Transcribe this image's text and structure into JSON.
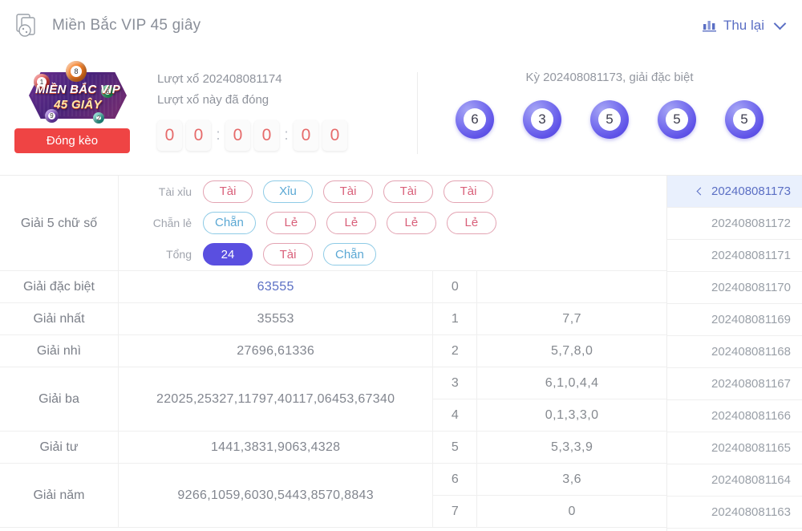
{
  "header": {
    "icon": "cards-dice-icon",
    "title": "Miền Bắc VIP 45 giây",
    "right_icon": "bar-chart-icon",
    "right_label": "Thu lại",
    "right_chevron": "chevron-down-icon"
  },
  "hero": {
    "logo": {
      "line1": "MIỀN BẮC VIP",
      "line2": "45 GIÂY",
      "ball_labels": [
        "8",
        "9",
        "1",
        "6",
        "2"
      ]
    },
    "closed_button": "Đóng kèo",
    "draw_line1": "Lượt xổ 202408081174",
    "draw_line2": "Lượt xổ này đã đóng",
    "timer": [
      "0",
      "0",
      ":",
      "0",
      "0",
      ":",
      "0",
      "0"
    ],
    "result_caption": "Kỳ 202408081173, giải đặc biệt",
    "result_balls": [
      "6",
      "3",
      "5",
      "5",
      "5"
    ]
  },
  "five_digit_block": {
    "label": "Giải 5 chữ số",
    "rows": [
      {
        "label": "Tài xỉu",
        "pills": [
          {
            "text": "Tài",
            "style": "red"
          },
          {
            "text": "Xỉu",
            "style": "cyan"
          },
          {
            "text": "Tài",
            "style": "red"
          },
          {
            "text": "Tài",
            "style": "red"
          },
          {
            "text": "Tài",
            "style": "red"
          }
        ]
      },
      {
        "label": "Chẵn lẻ",
        "pills": [
          {
            "text": "Chẵn",
            "style": "cyan"
          },
          {
            "text": "Lẻ",
            "style": "red"
          },
          {
            "text": "Lẻ",
            "style": "red"
          },
          {
            "text": "Lẻ",
            "style": "red"
          },
          {
            "text": "Lẻ",
            "style": "red"
          }
        ]
      },
      {
        "label": "Tổng",
        "pills": [
          {
            "text": "24",
            "style": "filled"
          },
          {
            "text": "Tài",
            "style": "red"
          },
          {
            "text": "Chẵn",
            "style": "cyan"
          }
        ]
      }
    ]
  },
  "prizes": [
    {
      "label": "Giải đặc biệt",
      "value": "63555",
      "highlight": true
    },
    {
      "label": "Giải nhất",
      "value": "35553",
      "highlight": false
    },
    {
      "label": "Giải nhì",
      "value": "27696,61336",
      "highlight": false
    },
    {
      "label": "Giải ba",
      "value": "22025,25327,11797,40117,06453,67340",
      "highlight": false
    },
    {
      "label": "Giải tư",
      "value": "1441,3831,9063,4328",
      "highlight": false
    },
    {
      "label": "Giải năm",
      "value": "9266,1059,6030,5443,8570,8843",
      "highlight": false
    }
  ],
  "digit_table": [
    {
      "key": "0",
      "value": ""
    },
    {
      "key": "1",
      "value": "7,7"
    },
    {
      "key": "2",
      "value": "5,7,8,0"
    },
    {
      "key": "3",
      "value": "6,1,0,4,4"
    },
    {
      "key": "4",
      "value": "0,1,3,3,0"
    },
    {
      "key": "5",
      "value": "5,3,3,9"
    },
    {
      "key": "6",
      "value": "3,6"
    },
    {
      "key": "7",
      "value": "0"
    }
  ],
  "sessions": [
    {
      "id": "202408081173",
      "active": true
    },
    {
      "id": "202408081172",
      "active": false
    },
    {
      "id": "202408081171",
      "active": false
    },
    {
      "id": "202408081170",
      "active": false
    },
    {
      "id": "202408081169",
      "active": false
    },
    {
      "id": "202408081168",
      "active": false
    },
    {
      "id": "202408081167",
      "active": false
    },
    {
      "id": "202408081166",
      "active": false
    },
    {
      "id": "202408081165",
      "active": false
    },
    {
      "id": "202408081164",
      "active": false
    },
    {
      "id": "202408081163",
      "active": false
    }
  ],
  "colors": {
    "accent_blue": "#5b6fc4",
    "pill_red": "#d9607a",
    "pill_cyan": "#5ba8d4",
    "filled_purple": "#5a4fe0",
    "timer_red": "#e66a6a",
    "closed_red": "#ef4444"
  }
}
